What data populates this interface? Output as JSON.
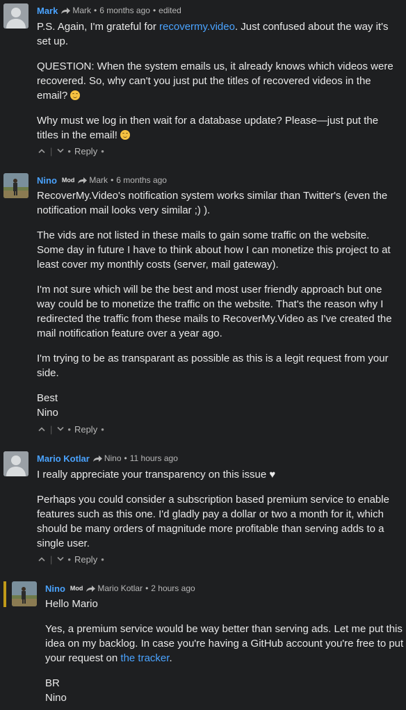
{
  "comments": [
    {
      "author": "Mark",
      "mod_badge": "",
      "reply_to": "Mark",
      "time": "6 months ago",
      "edited": "edited",
      "paragraphs": [
        {
          "pre": "P.S. Again, I'm grateful for ",
          "link": "recovermy.video",
          "post": ". Just confused about the way it's set up."
        },
        {
          "pre": "QUESTION: When the system emails us, it already knows which videos were recovered. So, why can't you just put the titles of recovered videos in the email? "
        },
        {
          "pre": "Why must we log in then wait for a database update? Please—just put the titles in the email! "
        }
      ],
      "reply_label": "Reply"
    },
    {
      "author": "Nino",
      "mod_badge": "Mod",
      "reply_to": "Mark",
      "time": "6 months ago",
      "paragraphs": [
        "RecoverMy.Video's notification system works similar than Twitter's (even the notification mail looks very similar ;) ).",
        "The vids are not listed in these mails to gain some traffic on the website. Some day in future I have to think about how I can monetize this project to at least cover my monthly costs (server, mail gateway).",
        "I'm not sure which will be the best and most user friendly approach but one way could be to monetize the traffic on the website. That's the reason why I redirected the traffic from these mails to RecoverMy.Video as I've created the mail notification feature over a year ago.",
        "I'm trying to be as transparant as possible as this is a legit request from your side.",
        "Best",
        "Nino"
      ],
      "reply_label": "Reply"
    },
    {
      "author": "Mario Kotlar",
      "mod_badge": "",
      "reply_to": "Nino",
      "time": "11 hours ago",
      "paragraphs": [
        "I really appreciate your transparency on this issue ♥",
        "Perhaps you could consider a subscription based premium service to enable features such as this one. I'd gladly pay a dollar or two a month for it, which should be many orders of magnitude more profitable than serving adds to a single user."
      ],
      "reply_label": "Reply"
    },
    {
      "author": "Nino",
      "mod_badge": "Mod",
      "reply_to": "Mario Kotlar",
      "time": "2 hours ago",
      "paragraphs": [
        "Hello Mario",
        {
          "pre": "Yes, a premium service would be way better than serving ads. Let me put this idea on my backlog. In case you're having a GitHub account you're free to put your request on ",
          "link": "the tracker",
          "post": "."
        },
        "BR",
        "Nino"
      ]
    }
  ],
  "ui": {
    "dot": "•",
    "bar": "|"
  },
  "colors": {
    "background": "#1e1f21",
    "author": "#4aa3ff",
    "link": "#4aa3ff",
    "highlight": "#c09a18"
  },
  "icons": [
    "reply-arrow-icon",
    "upvote-chevron-icon",
    "downvote-chevron-icon",
    "smiley-emoji-icon",
    "default-avatar-icon"
  ]
}
